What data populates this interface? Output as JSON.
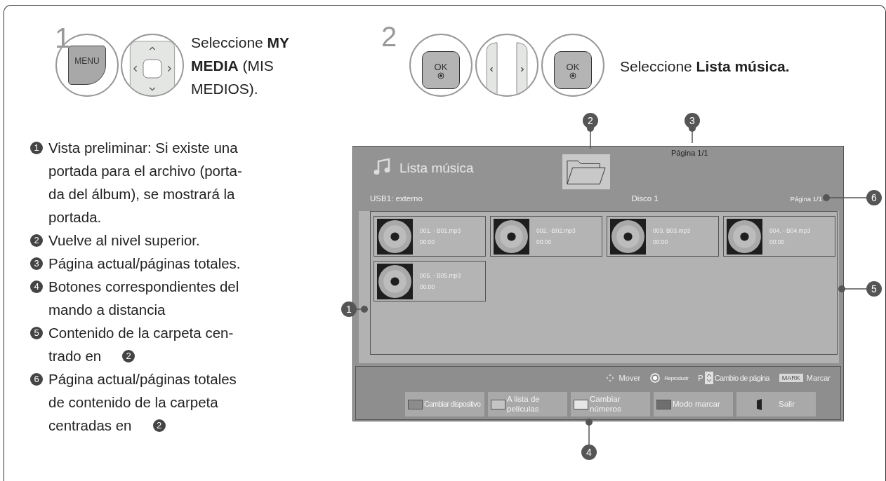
{
  "steps": [
    {
      "number": "1",
      "keys": [
        {
          "kind": "menu",
          "label": "MENU"
        },
        {
          "kind": "nav"
        }
      ],
      "lines": [
        "Seleccione **MY**",
        "**MEDIA** (MIS",
        "MEDIOS)."
      ]
    },
    {
      "number": "2",
      "keys": [
        {
          "kind": "ok",
          "label": "OK"
        },
        {
          "kind": "leftright"
        },
        {
          "kind": "ok",
          "label": "OK"
        }
      ],
      "lines": [
        "Seleccione **Lista música.**"
      ]
    }
  ],
  "notes": [
    {
      "number": "1",
      "lines": [
        "Vista preliminar: Si existe una",
        "portada para el archivo (porta-",
        "da del álbum), se mostrará la",
        "portada."
      ]
    },
    {
      "number": "2",
      "lines": [
        "Vuelve al nivel superior."
      ]
    },
    {
      "number": "3",
      "lines": [
        "Página actual/páginas totales."
      ]
    },
    {
      "number": "4",
      "lines": [
        "Botones correspondientes del",
        "mando a distancia"
      ]
    },
    {
      "number": "5",
      "lines": [
        "Contenido de la carpeta cen-",
        "trado en"
      ],
      "ref": "2"
    },
    {
      "number": "6",
      "lines": [
        "Página actual/páginas totales",
        "de contenido de la carpeta",
        "centradas en"
      ],
      "ref": "2"
    }
  ],
  "screen": {
    "title": "Lista música",
    "top_page": "Página 1/1",
    "device": "USB1: externo",
    "folder": "Disco 1",
    "page": "Página 1/1",
    "files": [
      {
        "name": "001. - B01.mp3",
        "time": "00:00"
      },
      {
        "name": "002. -B02.mp3",
        "time": "00:00"
      },
      {
        "name": "003. B03.mp3",
        "time": "00:00"
      },
      {
        "name": "004. - B04.mp3",
        "time": "00:00"
      },
      {
        "name": "005. - B05.mp3",
        "time": "00:00"
      }
    ],
    "hints": [
      {
        "kind": "move",
        "label": "Mover"
      },
      {
        "kind": "play",
        "label": "Reproducir"
      },
      {
        "kind": "page",
        "key": "P",
        "label": "Cambio de página"
      },
      {
        "kind": "mark",
        "key": "MARK",
        "label": "Marcar"
      }
    ],
    "buttons": [
      {
        "kind": "swatch",
        "label": "Cambiar dispositivo",
        "color": "#8c8c8c"
      },
      {
        "kind": "swatch",
        "label": "A lista de películas",
        "color": "#c4c4c4"
      },
      {
        "kind": "swatch",
        "label": "Cambiar números",
        "color": "#e6e6e6"
      },
      {
        "kind": "swatch",
        "label": "Modo marcar",
        "color": "#6e6e6e"
      },
      {
        "kind": "exit",
        "label": "Salir"
      }
    ]
  },
  "callouts": [
    "1",
    "2",
    "3",
    "4",
    "5",
    "6"
  ]
}
